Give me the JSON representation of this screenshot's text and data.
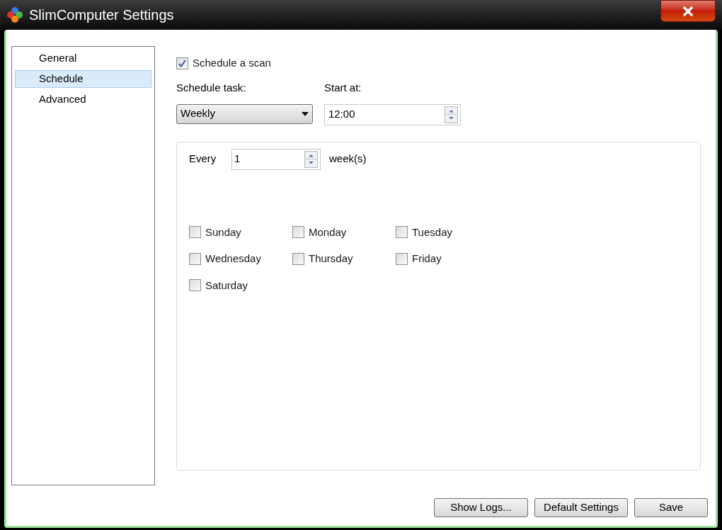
{
  "window": {
    "title": "SlimComputer Settings"
  },
  "sidebar": {
    "items": [
      {
        "label": "General",
        "selected": false
      },
      {
        "label": "Schedule",
        "selected": true
      },
      {
        "label": "Advanced",
        "selected": false
      }
    ]
  },
  "schedule_scan": {
    "label": "Schedule a scan",
    "checked": true
  },
  "schedule_task": {
    "label": "Schedule task:",
    "value": "Weekly"
  },
  "start_at": {
    "label": "Start at:",
    "value": "12:00"
  },
  "every": {
    "label": "Every",
    "value": "1",
    "unit": "week(s)"
  },
  "days": [
    {
      "label": "Sunday",
      "checked": false
    },
    {
      "label": "Monday",
      "checked": false
    },
    {
      "label": "Tuesday",
      "checked": false
    },
    {
      "label": "Wednesday",
      "checked": false
    },
    {
      "label": "Thursday",
      "checked": false
    },
    {
      "label": "Friday",
      "checked": false
    },
    {
      "label": "Saturday",
      "checked": false
    }
  ],
  "buttons": [
    "Show Logs...",
    "Default Settings",
    "Save"
  ]
}
